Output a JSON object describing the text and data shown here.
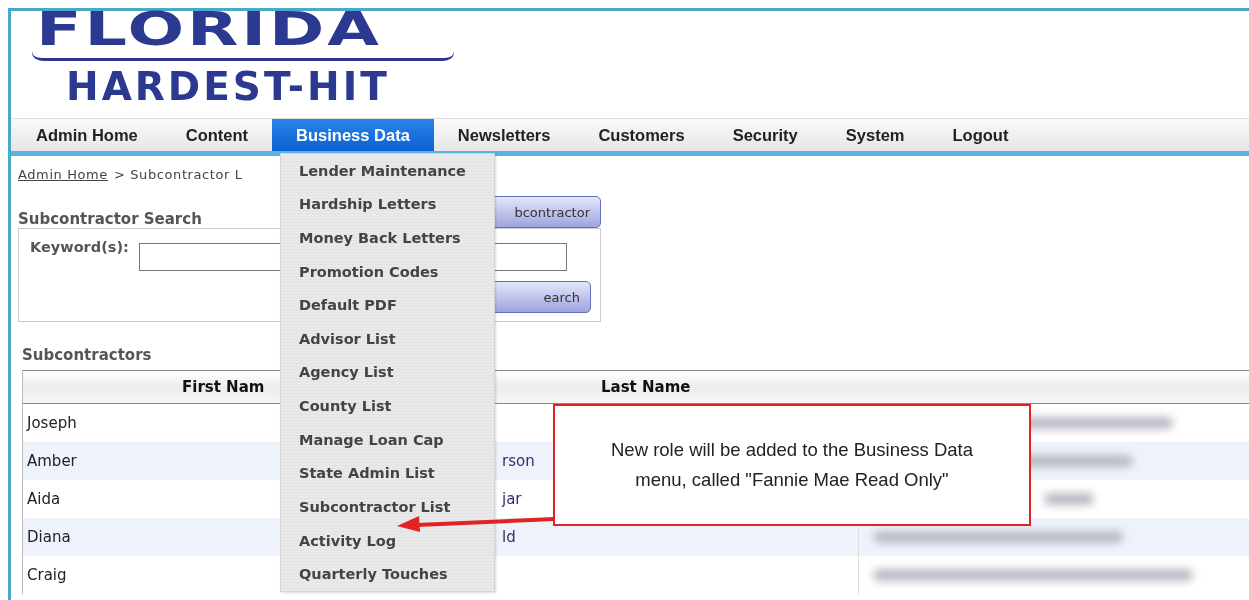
{
  "logo": {
    "line_1": "FLORIDA",
    "line_2": "HARDEST-HIT"
  },
  "nav": [
    {
      "label": "Admin Home",
      "selected": false
    },
    {
      "label": "Content",
      "selected": false
    },
    {
      "label": "Business Data",
      "selected": true
    },
    {
      "label": "Newsletters",
      "selected": false
    },
    {
      "label": "Customers",
      "selected": false
    },
    {
      "label": "Security",
      "selected": false
    },
    {
      "label": "System",
      "selected": false
    },
    {
      "label": "Logout",
      "selected": false
    }
  ],
  "breadcrumb": {
    "link": "Admin Home",
    "rest": "> Subcontractor L"
  },
  "search": {
    "title": "Subcontractor Search",
    "keyword_label": "Keyword(s):",
    "add_button": "bcontractor",
    "search_button": "earch"
  },
  "table": {
    "title": "Subcontractors",
    "columns": [
      "First Nam",
      "Last Name"
    ],
    "rows": [
      {
        "first_name": "Joseph"
      },
      {
        "first_name": "Amber",
        "last_name": "rson"
      },
      {
        "first_name": "Aida",
        "last_name": "jar"
      },
      {
        "first_name": "Diana",
        "last_name": "ld"
      },
      {
        "first_name": "Craig"
      }
    ]
  },
  "dropdown": {
    "items": [
      "Lender Maintenance",
      "Hardship Letters",
      "Money Back Letters",
      "Promotion Codes",
      "Default PDF",
      "Advisor List",
      "Agency List",
      "County List",
      "Manage Loan Cap",
      "State Admin List",
      "Subcontractor List",
      "Activity Log",
      "Quarterly Touches"
    ]
  },
  "callout": {
    "text": "New role will be added to the Business Data menu, called \"Fannie Mae Read Only\""
  }
}
